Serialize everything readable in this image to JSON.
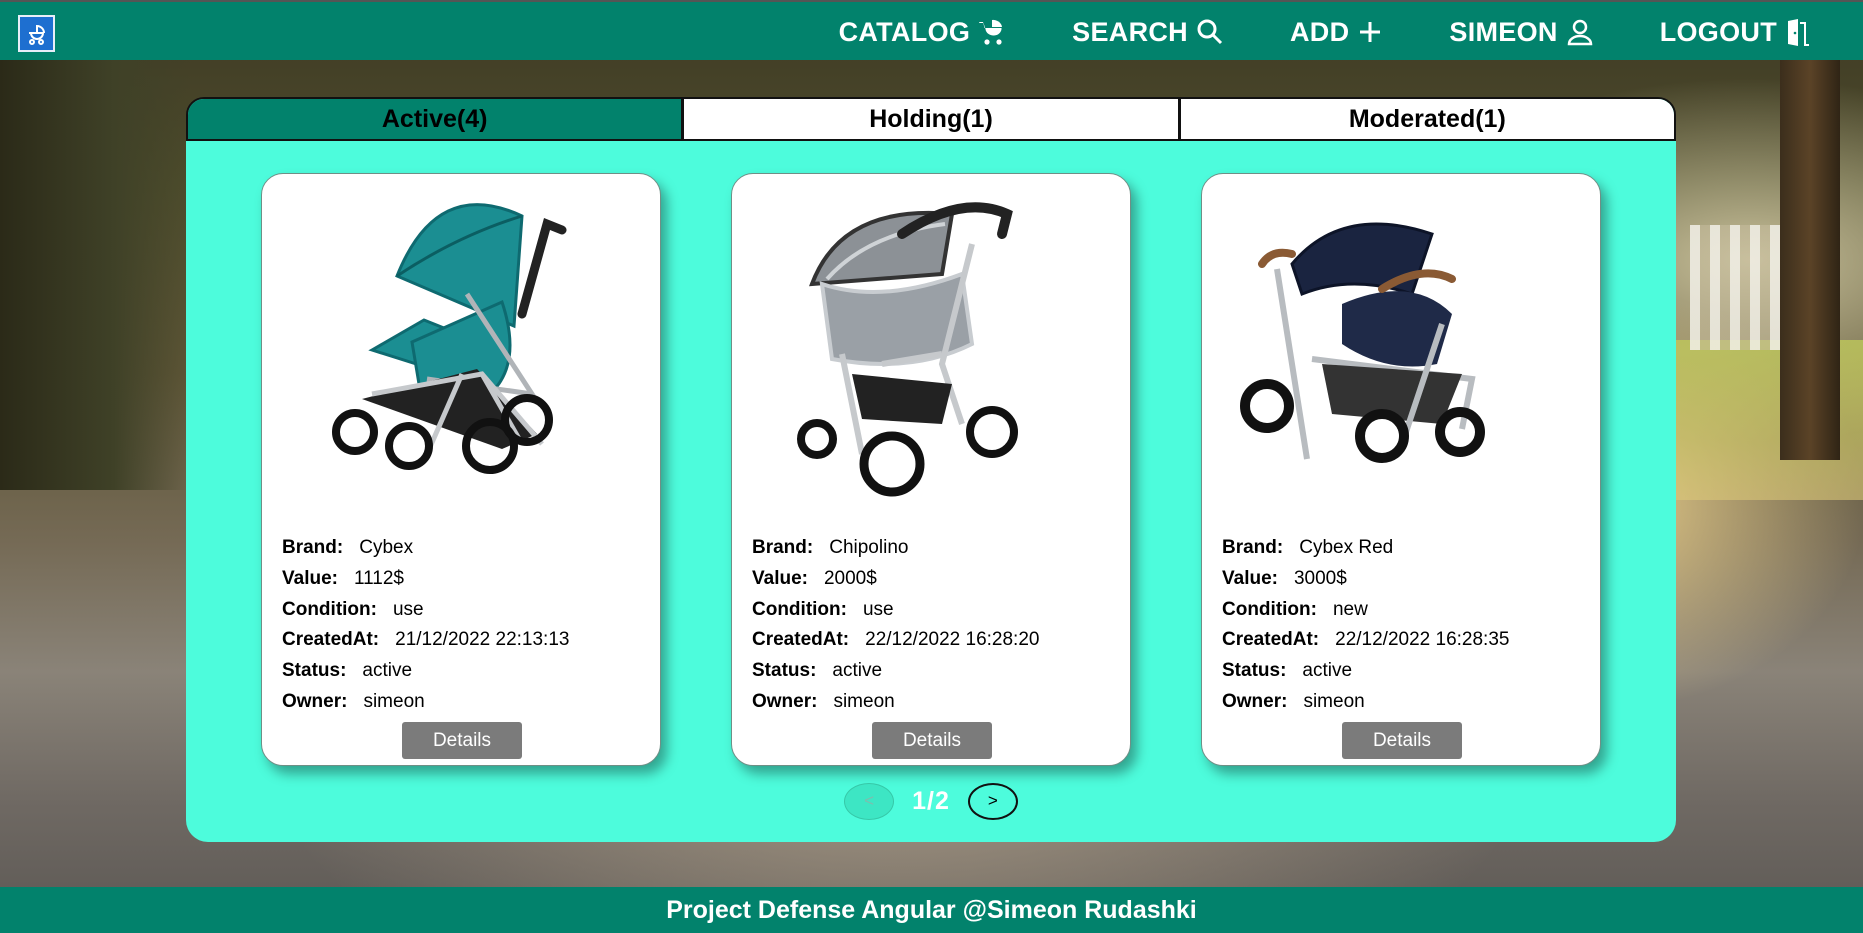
{
  "nav": {
    "items": [
      {
        "label": "CATALOG",
        "icon": "stroller-icon"
      },
      {
        "label": "SEARCH",
        "icon": "search-icon"
      },
      {
        "label": "ADD",
        "icon": "plus-icon"
      },
      {
        "label": "SIMEON",
        "icon": "user-icon"
      },
      {
        "label": "LOGOUT",
        "icon": "door-icon"
      }
    ]
  },
  "tabs": [
    {
      "label": "Active(4)",
      "active": true
    },
    {
      "label": "Holding(1)",
      "active": false
    },
    {
      "label": "Moderated(1)",
      "active": false
    }
  ],
  "field_labels": {
    "brand": "Brand:",
    "value": "Value:",
    "condition": "Condition:",
    "created": "CreatedAt:",
    "status": "Status:",
    "owner": "Owner:"
  },
  "cards": [
    {
      "brand": "Cybex",
      "value": "1112$",
      "condition": "use",
      "created": "21/12/2022 22:13:13",
      "status": "active",
      "owner": "simeon",
      "button": "Details"
    },
    {
      "brand": "Chipolino",
      "value": "2000$",
      "condition": "use",
      "created": "22/12/2022 16:28:20",
      "status": "active",
      "owner": "simeon",
      "button": "Details"
    },
    {
      "brand": "Cybex Red",
      "value": "3000$",
      "condition": "new",
      "created": "22/12/2022 16:28:35",
      "status": "active",
      "owner": "simeon",
      "button": "Details"
    }
  ],
  "pagination": {
    "prev": "<",
    "page": "1/2",
    "next": ">"
  },
  "footer": "Project Defense Angular @Simeon Rudashki",
  "colors": {
    "brand": "#02826c",
    "panel": "#4dfcdc",
    "button": "#7b7b7b"
  }
}
